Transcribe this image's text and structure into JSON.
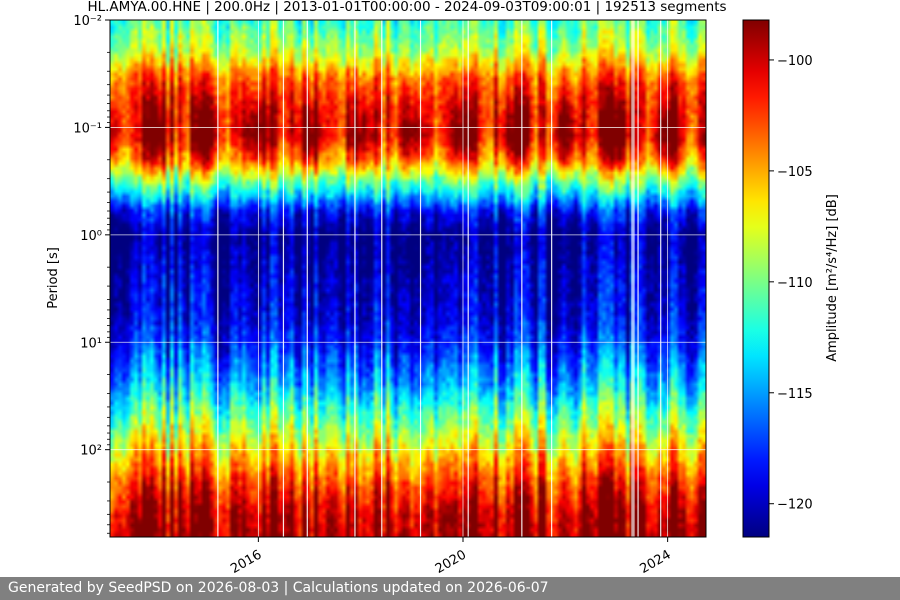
{
  "chart_data": {
    "type": "heatmap",
    "title": "HL.AMYA.00.HNE | 200.0Hz | 2013-01-01T00:00:00 - 2024-09-03T09:00:01 | 192513 segments",
    "ylabel": "Period [s]",
    "colorbar_label": "Amplitude [m²/s⁴/Hz] [dB]",
    "x_ticks": [
      "2016",
      "2020",
      "2024"
    ],
    "x_tick_values": [
      2016.0,
      2020.0,
      2024.0
    ],
    "x_range": [
      2013.1,
      2024.75
    ],
    "y_scale": "log",
    "y_range": [
      0.01,
      650
    ],
    "y_ticks": [
      {
        "value": 0.01,
        "label": "10⁻²"
      },
      {
        "value": 0.1,
        "label": "10⁻¹"
      },
      {
        "value": 1,
        "label": "10⁰"
      },
      {
        "value": 10,
        "label": "10¹"
      },
      {
        "value": 100,
        "label": "10²"
      }
    ],
    "colorbar_range": [
      -121.5,
      -98.2
    ],
    "colorbar_ticks": [
      -100,
      -105,
      -110,
      -115,
      -120
    ],
    "colormap": "jet",
    "grid": true,
    "amplitude_profile": [
      {
        "period": 0.01,
        "db": -111
      },
      {
        "period": 0.02,
        "db": -108
      },
      {
        "period": 0.035,
        "db": -103
      },
      {
        "period": 0.07,
        "db": -100
      },
      {
        "period": 0.12,
        "db": -99
      },
      {
        "period": 0.2,
        "db": -103
      },
      {
        "period": 0.3,
        "db": -109
      },
      {
        "period": 0.45,
        "db": -114
      },
      {
        "period": 0.6,
        "db": -118
      },
      {
        "period": 1.0,
        "db": -121
      },
      {
        "period": 2.0,
        "db": -120
      },
      {
        "period": 3.0,
        "db": -119.5
      },
      {
        "period": 6.0,
        "db": -119
      },
      {
        "period": 12.0,
        "db": -117
      },
      {
        "period": 25.0,
        "db": -114
      },
      {
        "period": 50.0,
        "db": -110
      },
      {
        "period": 100.0,
        "db": -106
      },
      {
        "period": 200.0,
        "db": -102
      },
      {
        "period": 400.0,
        "db": -99
      },
      {
        "period": 650.0,
        "db": -98.5
      }
    ]
  },
  "footer": {
    "text": "Generated by SeedPSD on 2026-08-03 | Calculations updated on 2026-06-07"
  }
}
